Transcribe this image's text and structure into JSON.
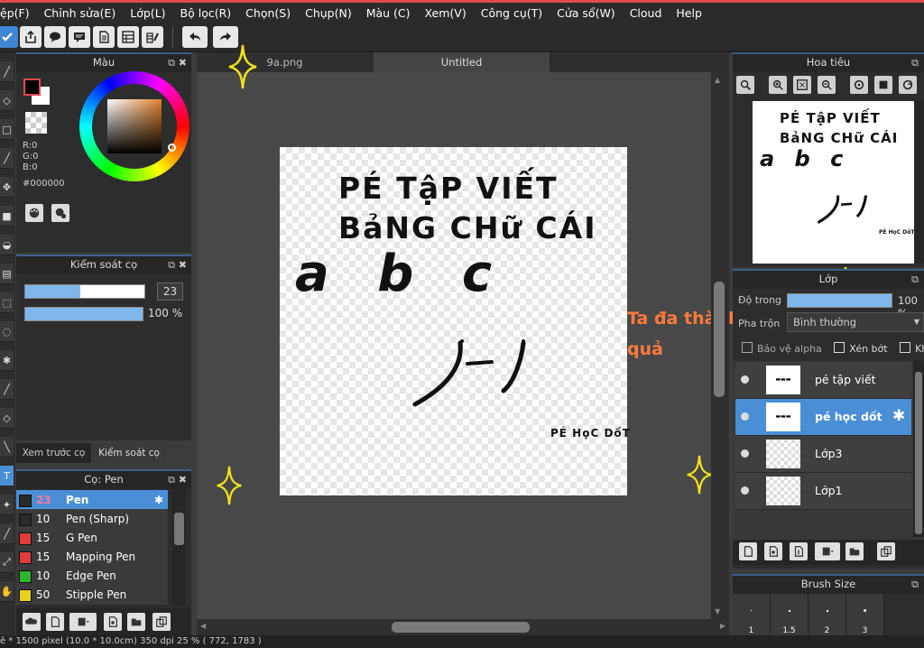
{
  "menu": [
    "ệp(F)",
    "Chỉnh sửa(E)",
    "Lớp(L)",
    "Bộ lọc(R)",
    "Chọn(S)",
    "Chụp(N)",
    "Màu (C)",
    "Xem(V)",
    "Công cụ(T)",
    "Cửa sổ(W)",
    "Cloud",
    "Help"
  ],
  "color_panel": {
    "title": "Màu",
    "r": "R:0",
    "g": "G:0",
    "b": "B:0",
    "hex": "#000000"
  },
  "brush_control": {
    "title": "Kiểm soát cọ",
    "size": "23",
    "opacity": "100 %",
    "size_fraction": 0.46,
    "opacity_fraction": 1.0
  },
  "left_tabs": [
    "Xem trước cọ",
    "Kiểm soát cọ"
  ],
  "brush_panel": {
    "title": "Cọ: Pen",
    "items": [
      {
        "size": "23",
        "name": "Pen",
        "color": "#2a2a2a"
      },
      {
        "size": "10",
        "name": "Pen (Sharp)",
        "color": "#2a2a2a"
      },
      {
        "size": "15",
        "name": "G Pen",
        "color": "#e23b3b"
      },
      {
        "size": "15",
        "name": "Mapping Pen",
        "color": "#e23b3b"
      },
      {
        "size": "10",
        "name": "Edge Pen",
        "color": "#2fb52f"
      },
      {
        "size": "50",
        "name": "Stipple Pen",
        "color": "#e6d11f"
      }
    ]
  },
  "canvas_tabs": [
    "9a.png",
    "Untitled"
  ],
  "artwork": {
    "line1": "PÉ TậP VIẾT",
    "line2": "BảNG CHữ CÁI",
    "letters": "a b c",
    "caption": "PÉ HọC DốT"
  },
  "annotation": {
    "line1": "Ta đa thành",
    "line2": "quả"
  },
  "navigator": {
    "title": "Hoa tiêu"
  },
  "layer_panel": {
    "title": "Lớp",
    "opacity_label": "Độ trong",
    "opacity_value": "100 %",
    "blend_label": "Pha trộn",
    "blend_value": "Bình thường",
    "protect_alpha": "Bảo vệ alpha",
    "clip": "Xén bớt",
    "lock": "Khóa",
    "layers": [
      "pé tập viết",
      "pé học dốt",
      "Lớp3",
      "Lớp1"
    ]
  },
  "brush_size_panel": {
    "title": "Brush Size",
    "sizes": [
      "1",
      "1.5",
      "2",
      "3"
    ]
  },
  "status": "ê * 1500 pixel   (10.0 * 10.0cm)   350 dpi   25 %   ( 772, 1783 )",
  "colors": {
    "accent": "#4a90d9",
    "selected_layer": "#4a8fd6",
    "annotation": "#ff7a3c",
    "sparkle": "#f2e11a"
  }
}
